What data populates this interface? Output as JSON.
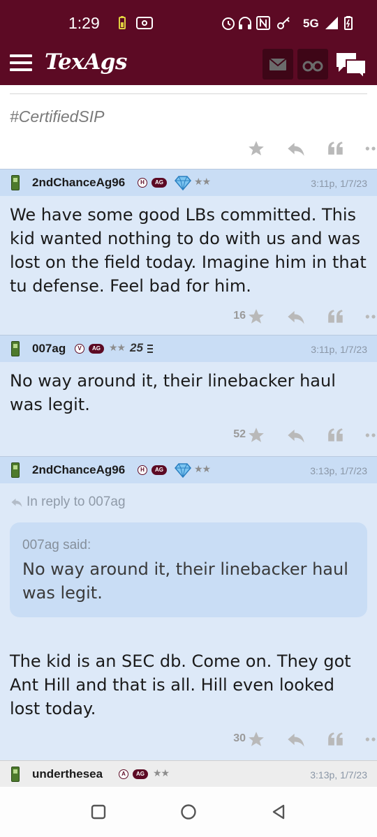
{
  "status_bar": {
    "time": "1:29",
    "network": "5G",
    "icons": [
      "battery-saver-icon",
      "nfc-icon",
      "alarm-icon",
      "headphones-icon",
      "key-icon",
      "signal-icon",
      "battery-icon"
    ]
  },
  "app_bar": {
    "brand": "TexAgs",
    "icons": [
      "menu-icon",
      "mail-icon",
      "binoculars-icon",
      "chat-icon"
    ]
  },
  "top_post": {
    "signature": "#CertifiedSIP"
  },
  "posts": [
    {
      "username": "2ndChanceAg96",
      "badge": "H",
      "ag_badge": "AG",
      "stars": "★★",
      "timestamp": "3:11p, 1/7/23",
      "body": "We have some good LBs committed. This kid wanted nothing to do with us and was lost on the field today. Imagine him in that tu defense. Feel bad for him.",
      "star_count": "16"
    },
    {
      "username": "007ag",
      "badge": "V",
      "ag_badge": "AG",
      "stars": "★★",
      "extra_badge": "25",
      "timestamp": "3:11p, 1/7/23",
      "body": "No way around it, their linebacker haul was legit.",
      "star_count": "52"
    },
    {
      "username": "2ndChanceAg96",
      "badge": "H",
      "ag_badge": "AG",
      "stars": "★★",
      "timestamp": "3:13p, 1/7/23",
      "reply_to": "In reply to 007ag",
      "quote_author": "007ag said:",
      "quote_text": "No way around it, their linebacker haul was legit.",
      "body": "The kid is an SEC db. Come on. They got Ant Hill and that is all. Hill even looked lost today.",
      "star_count": "30"
    },
    {
      "username": "underthesea",
      "badge": "A",
      "ag_badge": "AG",
      "stars": "★★",
      "timestamp": "3:13p, 1/7/23"
    }
  ],
  "colors": {
    "maroon": "#5c0a24",
    "post_bg": "#dde9f8",
    "header_bg": "#c9ddf5"
  }
}
